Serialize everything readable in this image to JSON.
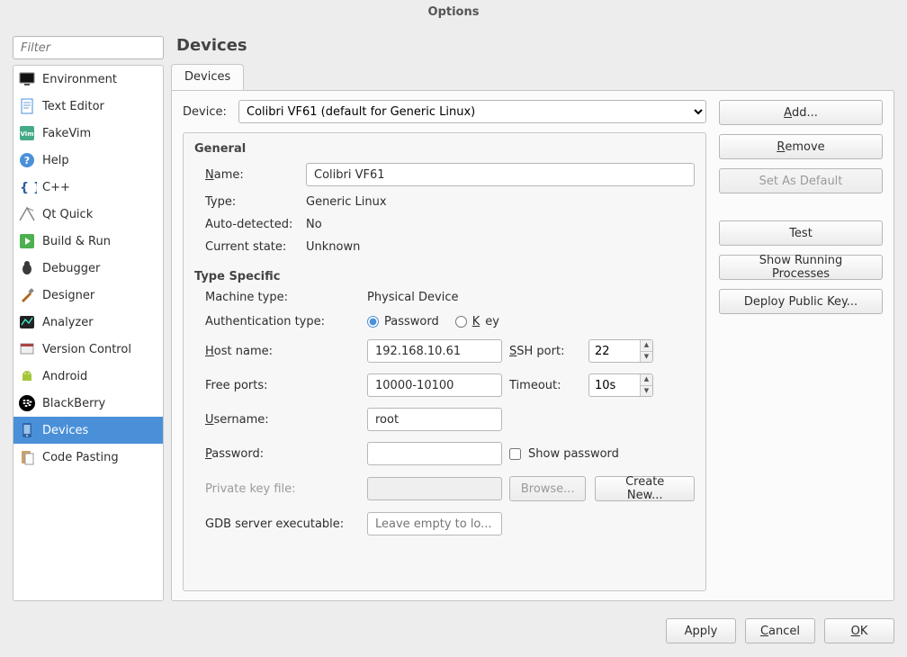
{
  "window": {
    "title": "Options"
  },
  "sidebar": {
    "filter_placeholder": "Filter",
    "categories": [
      {
        "label": "Environment"
      },
      {
        "label": "Text Editor"
      },
      {
        "label": "FakeVim"
      },
      {
        "label": "Help"
      },
      {
        "label": "C++"
      },
      {
        "label": "Qt Quick"
      },
      {
        "label": "Build & Run"
      },
      {
        "label": "Debugger"
      },
      {
        "label": "Designer"
      },
      {
        "label": "Analyzer"
      },
      {
        "label": "Version Control"
      },
      {
        "label": "Android"
      },
      {
        "label": "BlackBerry"
      },
      {
        "label": "Devices"
      },
      {
        "label": "Code Pasting"
      }
    ],
    "selected_index": 13
  },
  "page": {
    "title": "Devices",
    "tab_label": "Devices"
  },
  "device": {
    "label": "Device:",
    "selected": "Colibri VF61 (default for Generic Linux)"
  },
  "side_buttons": {
    "add": "Add...",
    "remove": "Remove",
    "set_default": "Set As Default",
    "test": "Test",
    "show_processes": "Show Running Processes",
    "deploy_key": "Deploy Public Key..."
  },
  "general": {
    "group_title": "General",
    "name_label": "Name:",
    "name_value": "Colibri VF61",
    "type_label": "Type:",
    "type_value": "Generic Linux",
    "auto_label": "Auto-detected:",
    "auto_value": "No",
    "state_label": "Current state:",
    "state_value": "Unknown"
  },
  "type_specific": {
    "group_title": "Type Specific",
    "machine_label": "Machine type:",
    "machine_value": "Physical Device",
    "auth_label": "Authentication type:",
    "auth_pw": "Password",
    "auth_key": "Key",
    "auth_selected": "password",
    "host_label": "Host name:",
    "host_value": "192.168.10.61",
    "sshport_label": "SSH port:",
    "sshport_value": "22",
    "freeports_label": "Free ports:",
    "freeports_value": "10000-10100",
    "timeout_label": "Timeout:",
    "timeout_value": "10s",
    "username_label": "Username:",
    "username_value": "root",
    "password_label": "Password:",
    "password_value": "",
    "showpw_label": "Show password",
    "pkf_label": "Private key file:",
    "pkf_value": "",
    "browse_label": "Browse...",
    "createnew_label": "Create New...",
    "gdb_label": "GDB server executable:",
    "gdb_placeholder": "Leave empty to lo..."
  },
  "footer": {
    "apply": "Apply",
    "cancel": "Cancel",
    "ok": "OK"
  }
}
